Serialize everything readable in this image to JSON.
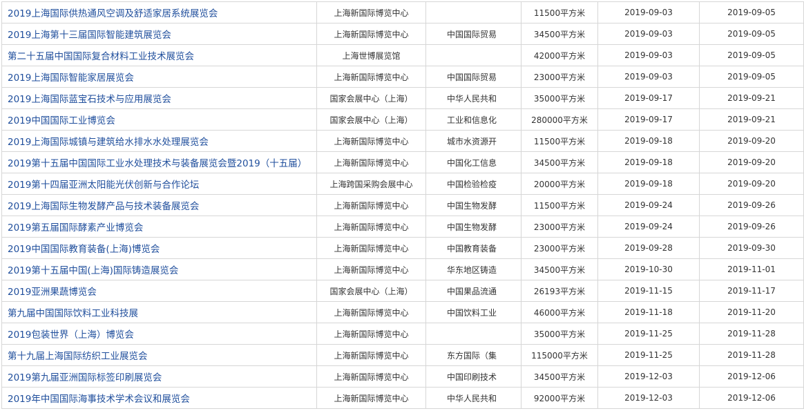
{
  "exhibitions": [
    {
      "name": "2019上海国际供热通风空调及舒适家居系统展览会",
      "venue": "上海新国际博览中心",
      "organizer": "",
      "area": "11500平方米",
      "start": "2019-09-03",
      "end": "2019-09-05"
    },
    {
      "name": "2019上海第十三届国际智能建筑展览会",
      "venue": "上海新国际博览中心",
      "organizer": "中国国际贸易",
      "area": "34500平方米",
      "start": "2019-09-03",
      "end": "2019-09-05"
    },
    {
      "name": "第二十五届中国国际复合材料工业技术展览会",
      "venue": "上海世博展览馆",
      "organizer": "",
      "area": "42000平方米",
      "start": "2019-09-03",
      "end": "2019-09-05"
    },
    {
      "name": "2019上海国际智能家居展览会",
      "venue": "上海新国际博览中心",
      "organizer": "中国国际贸易",
      "area": "23000平方米",
      "start": "2019-09-03",
      "end": "2019-09-05"
    },
    {
      "name": "2019上海国际蓝宝石技术与应用展览会",
      "venue": "国家会展中心（上海）",
      "organizer": "中华人民共和",
      "area": "35000平方米",
      "start": "2019-09-17",
      "end": "2019-09-21"
    },
    {
      "name": "2019中国国际工业博览会",
      "venue": "国家会展中心（上海）",
      "organizer": "工业和信息化",
      "area": "280000平方米",
      "start": "2019-09-17",
      "end": "2019-09-21"
    },
    {
      "name": "2019上海国际城镇与建筑给水排水水处理展览会",
      "venue": "上海新国际博览中心",
      "organizer": "城市水资源开",
      "area": "11500平方米",
      "start": "2019-09-18",
      "end": "2019-09-20"
    },
    {
      "name": "2019第十五届中国国际工业水处理技术与装备展览会暨2019（十五届）",
      "venue": "上海新国际博览中心",
      "organizer": "中国化工信息",
      "area": "34500平方米",
      "start": "2019-09-18",
      "end": "2019-09-20"
    },
    {
      "name": "2019第十四届亚洲太阳能光伏创新与合作论坛",
      "venue": "上海跨国采购会展中心",
      "organizer": "中国检验检疫",
      "area": "20000平方米",
      "start": "2019-09-18",
      "end": "2019-09-20"
    },
    {
      "name": "2019上海国际生物发酵产品与技术装备展览会",
      "venue": "上海新国际博览中心",
      "organizer": "中国生物发酵",
      "area": "11500平方米",
      "start": "2019-09-24",
      "end": "2019-09-26"
    },
    {
      "name": "2019第五届国际酵素产业博览会",
      "venue": "上海新国际博览中心",
      "organizer": "中国生物发酵",
      "area": "23000平方米",
      "start": "2019-09-24",
      "end": "2019-09-26"
    },
    {
      "name": "2019中国国际教育装备(上海)博览会",
      "venue": "上海新国际博览中心",
      "organizer": "中国教育装备",
      "area": "23000平方米",
      "start": "2019-09-28",
      "end": "2019-09-30"
    },
    {
      "name": "2019第十五届中国(上海)国际铸造展览会",
      "venue": "上海新国际博览中心",
      "organizer": "华东地区铸造",
      "area": "34500平方米",
      "start": "2019-10-30",
      "end": "2019-11-01"
    },
    {
      "name": "2019亚洲果蔬博览会",
      "venue": "国家会展中心（上海）",
      "organizer": "中国果品流通",
      "area": "26193平方米",
      "start": "2019-11-15",
      "end": "2019-11-17"
    },
    {
      "name": "第九届中国国际饮料工业科技展",
      "venue": "上海新国际博览中心",
      "organizer": "中国饮料工业",
      "area": "46000平方米",
      "start": "2019-11-18",
      "end": "2019-11-20"
    },
    {
      "name": "2019包装世界（上海）博览会",
      "venue": "上海新国际博览中心",
      "organizer": "",
      "area": "35000平方米",
      "start": "2019-11-25",
      "end": "2019-11-28"
    },
    {
      "name": "第十九届上海国际纺织工业展览会",
      "venue": "上海新国际博览中心",
      "organizer": "东方国际（集",
      "area": "115000平方米",
      "start": "2019-11-25",
      "end": "2019-11-28"
    },
    {
      "name": "2019第九届亚洲国际标签印刷展览会",
      "venue": "上海新国际博览中心",
      "organizer": "中国印刷技术",
      "area": "34500平方米",
      "start": "2019-12-03",
      "end": "2019-12-06"
    },
    {
      "name": "2019年中国国际海事技术学术会议和展览会",
      "venue": "上海新国际博览中心",
      "organizer": "中华人民共和",
      "area": "92000平方米",
      "start": "2019-12-03",
      "end": "2019-12-06"
    }
  ]
}
